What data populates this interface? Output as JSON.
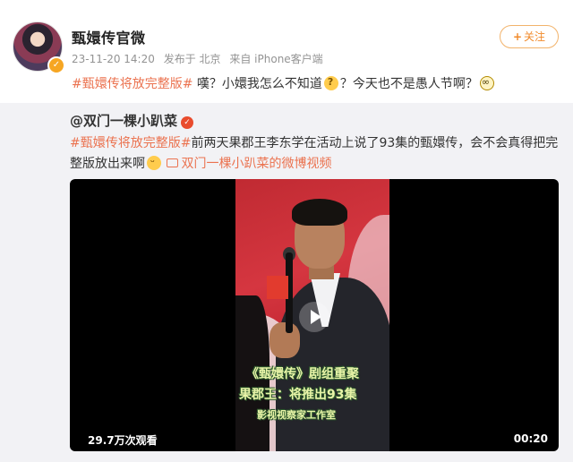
{
  "post": {
    "account_name": "甄嬛传官微",
    "timestamp": "23-11-20 14:20",
    "published_in": "发布于 北京",
    "source": "来自 iPhone客户端",
    "follow_label": "关注",
    "follow_icon": "plus-icon",
    "topic_tag": "#甄嬛传将放完整版#",
    "text_part1": " 嘆？小嬛我怎么不知道",
    "text_part2": "？今天也不是愚人节啊？",
    "emoji_1": "thinking-emoji",
    "emoji_2": "glasses-emoji",
    "badge_icon": "verified-badge-icon"
  },
  "repost": {
    "author": "@双门一棵小趴菜",
    "verified_icon": "verified-red-icon",
    "topic_tag": "#甄嬛传将放完整版#",
    "line1_text": "前两天果郡王李东学在活动上说了93集的甄嬛传，会不会真得把完",
    "line2_text": "整版放出来啊",
    "emoji": "laughing-emoji",
    "video_link_icon": "video-link-icon",
    "video_link_label": "双门一棵小趴菜的微博视频"
  },
  "video": {
    "view_count": "29.7万次观看",
    "duration": "00:20",
    "caption_1": "《甄嬛传》剧组重聚",
    "caption_2": "果郡王：将推出93集",
    "caption_3": "影视视察家工作室",
    "play_icon": "play-icon"
  },
  "colors": {
    "topic": "#eb7350",
    "follow_border": "#f2b36b",
    "repost_bg": "#f2f2f5",
    "video_bg": "#000000"
  }
}
